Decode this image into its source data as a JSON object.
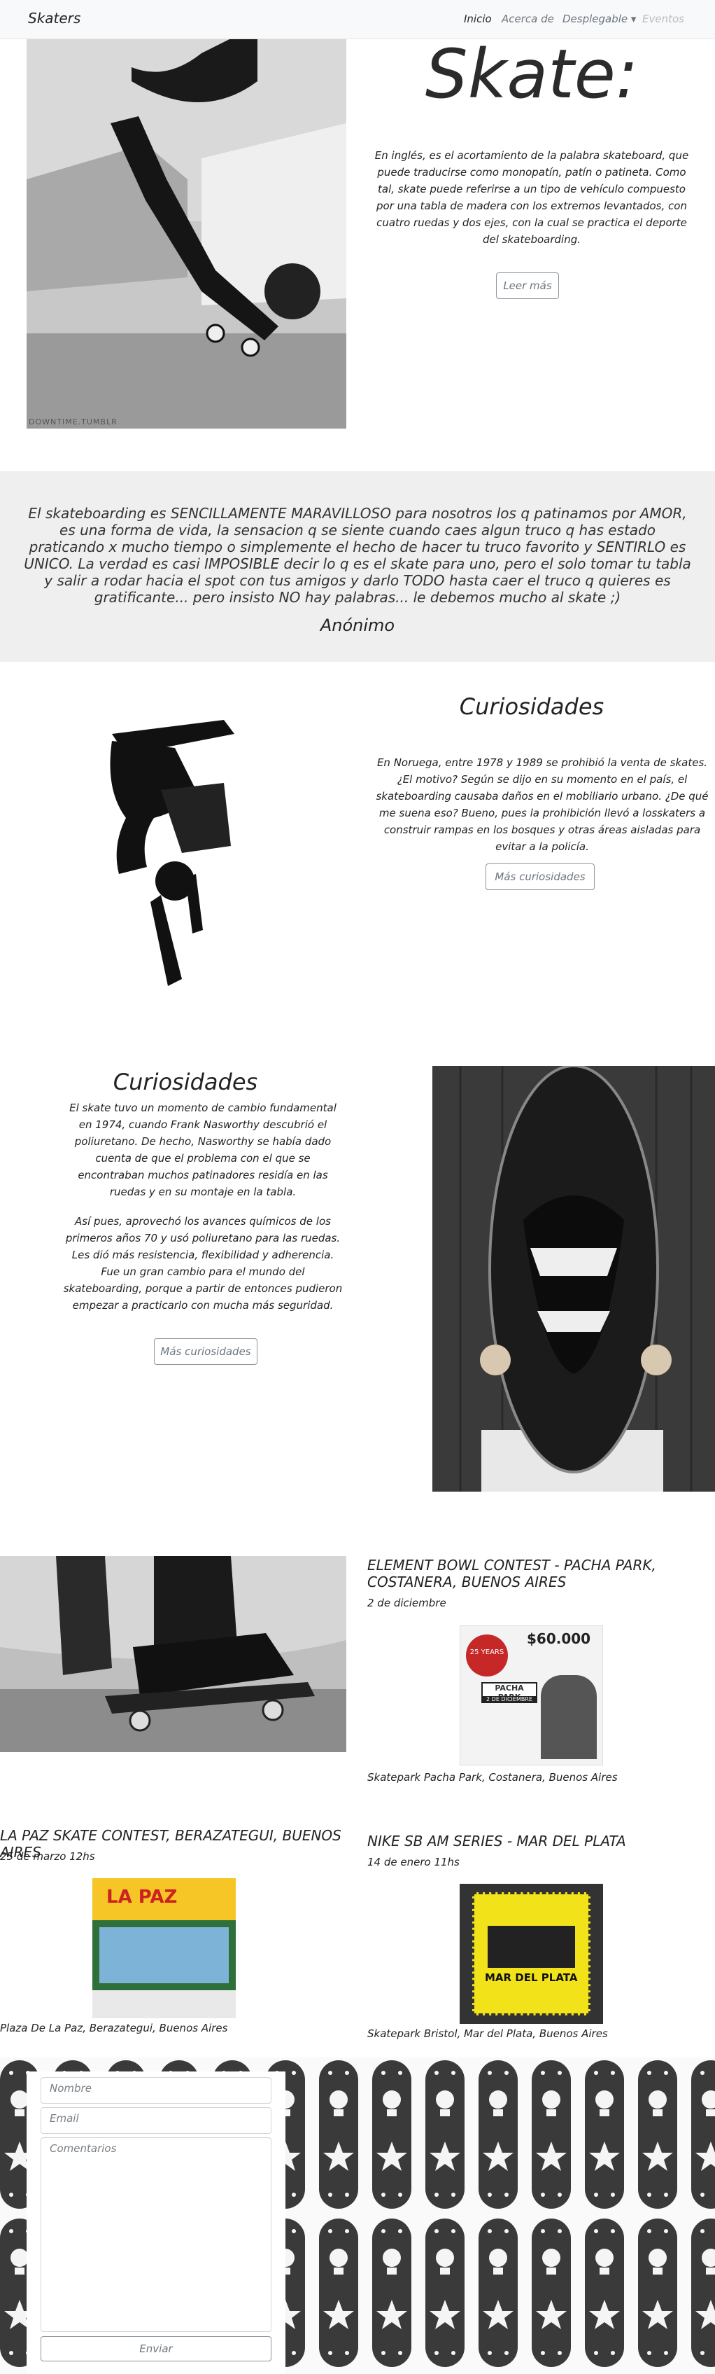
{
  "nav": {
    "brand": "Skaters",
    "links": [
      {
        "label": "Inicio"
      },
      {
        "label": "Acerca de"
      },
      {
        "label": "Desplegable ▾"
      },
      {
        "label": "Eventos"
      }
    ]
  },
  "hero": {
    "title": "Skate:",
    "text": "En inglés, es el acortamiento de la palabra skateboard, que puede traducirse como monopatín, patín o patineta. Como tal, skate puede referirse a un tipo de vehículo compuesto por una tabla de madera con los extremos levantados, con cuatro ruedas y dos ejes, con la cual se practica el deporte del skateboarding.",
    "button": "Leer más",
    "image_caption": "DOWNTIME.TUMBLR"
  },
  "quote": {
    "text": "El skateboarding es SENCILLAMENTE MARAVILLOSO para nosotros los q patinamos por AMOR, es una forma de vida, la sensacion q se siente cuando caes algun truco q has estado praticando x mucho tiempo o simplemente el hecho de hacer tu truco favorito y SENTIRLO es UNICO. La verdad es casi IMPOSIBLE decir lo q es el skate para uno, pero el solo tomar tu tabla y salir a rodar hacia el spot con tus amigos y darlo TODO hasta caer el truco q quieres es gratificante... pero insisto NO hay palabras... le debemos mucho al skate ;)",
    "author": "Anónimo"
  },
  "curiosidades1": {
    "title": "Curiosidades",
    "text": "En Noruega, entre 1978 y 1989 se prohibió la venta de skates. ¿El motivo? Según se dijo en su momento en el país, el skateboarding causaba daños en el mobiliario urbano. ¿De qué me suena eso? Bueno, pues la prohibición llevó a losskaters a construir rampas en los bosques y otras áreas aisladas para evitar a la policía.",
    "button": "Más curiosidades"
  },
  "curiosidades2": {
    "title": "Curiosidades",
    "text1": "El skate tuvo un momento de cambio fundamental en 1974, cuando Frank Nasworthy descubrió el poliuretano. De hecho, Nasworthy se había dado cuenta de que el problema con el que se encontraban muchos patinadores residía en las ruedas y en su montaje en la tabla.",
    "text2": "Así pues, aprovechó los avances químicos de los primeros años 70 y usó poliuretano para las ruedas. Les dió más resistencia, flexibilidad y adherencia. Fue un gran cambio para el mundo del skateboarding, porque a partir de entonces pudieron empezar a practicarlo con mucha más seguridad.",
    "button": "Más curiosidades"
  },
  "events": [
    {
      "title": "ELEMENT BOWL CONTEST - PACHA PARK, COSTANERA, BUENOS AIRES",
      "date": "2 de diciembre",
      "place": "Skatepark Pacha Park, Costanera, Buenos Aires",
      "poster_price": "$60.000",
      "poster_name": "PACHA PARK",
      "poster_years": "25 YEARS",
      "poster_date": "2 DE DICIEMBRE"
    },
    {
      "title": "LA PAZ SKATE CONTEST, BERAZATEGUI, BUENOS AIRES",
      "date": "25 de marzo 12hs",
      "place": "Plaza De La Paz, Berazategui, Buenos Aires",
      "poster_name": "LA PAZ"
    },
    {
      "title": "NIKE SB AM SERIES - MAR DEL PLATA",
      "date": "14 de enero 11hs",
      "place": "Skatepark Bristol, Mar del Plata, Buenos Aires",
      "poster_name": "MAR DEL PLATA"
    }
  ],
  "form": {
    "name_placeholder": "Nombre",
    "email_placeholder": "Email",
    "comments_placeholder": "Comentarios",
    "submit": "Enviar"
  }
}
